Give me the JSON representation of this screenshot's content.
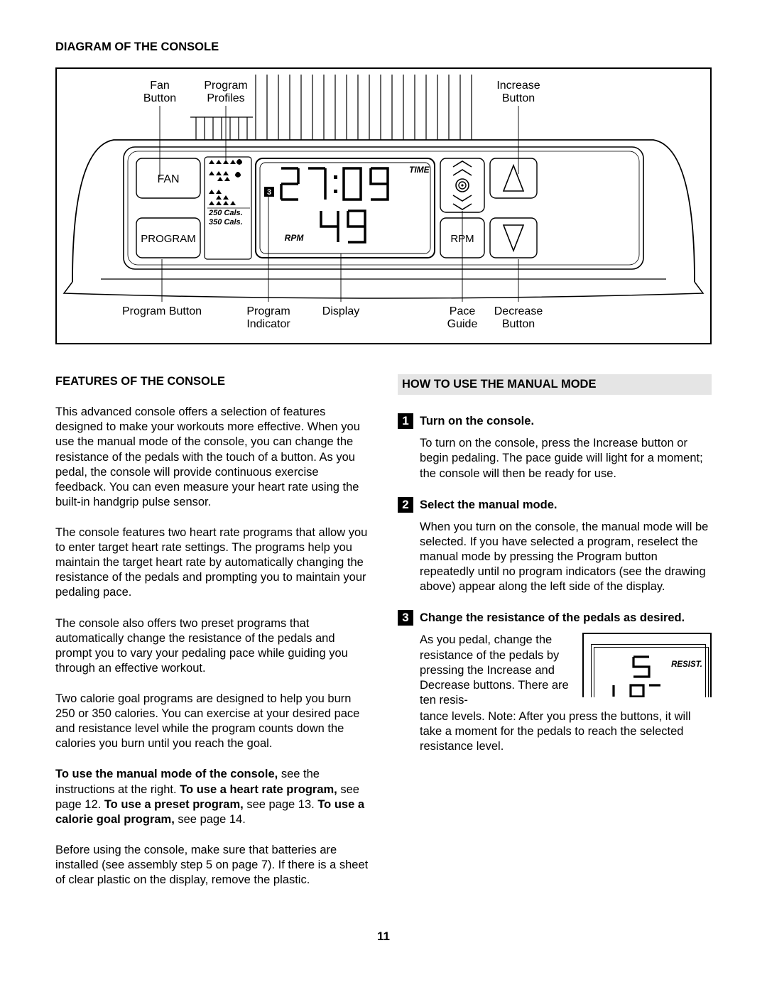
{
  "page_number": "11",
  "diagram": {
    "title": "DIAGRAM OF THE CONSOLE",
    "labels_top": {
      "fan_button": "Fan\nButton",
      "program_profiles": "Program\nProfiles",
      "increase_button": "Increase\nButton"
    },
    "labels_bottom": {
      "program_button": "Program Button",
      "program_indicator": "Program\nIndicator",
      "display": "Display",
      "pace_guide": "Pace\nGuide",
      "decrease_button": "Decrease\nButton"
    },
    "panel": {
      "fan": "FAN",
      "program": "PROGRAM",
      "cals_250": "250 Cals.",
      "cals_350": "350 Cals.",
      "indicator_num": "3",
      "time_label": "TIME",
      "rpm_small": "RPM",
      "big_time": "27:09",
      "big_rpm": "49",
      "rpm_btn": "RPM"
    }
  },
  "features": {
    "heading": "FEATURES OF THE CONSOLE",
    "p1": "This advanced console offers a selection of features designed to make your workouts more effective. When you use the manual mode of the console, you can change the resistance of the pedals with the touch of a button. As you pedal, the console will provide continuous exercise feedback. You can even measure your heart rate using the built-in handgrip pulse sensor.",
    "p2": "The console features two heart rate programs that allow you to enter target heart rate settings. The programs help you maintain the target heart rate by automatically changing the resistance of the pedals and prompting you to maintain your pedaling pace.",
    "p3": "The console also offers two preset programs that automatically change the resistance of the pedals and prompt you to vary your pedaling pace while guiding you through an effective workout.",
    "p4": "Two calorie goal programs are designed to help you burn 250 or 350 calories. You can exercise at your desired pace and resistance level while the program counts down the calories you burn until you reach the goal.",
    "p5_a": "To use the manual mode of the console,",
    "p5_b": " see the instructions at the right. ",
    "p5_c": "To use a heart rate program,",
    "p5_d": " see page 12. ",
    "p5_e": "To use a preset program,",
    "p5_f": " see page 13. ",
    "p5_g": "To use a calorie goal program,",
    "p5_h": " see page 14.",
    "p6": "Before using the console, make sure that batteries are installed (see assembly step 5 on page 7). If there is a sheet of clear plastic on the display, remove the plastic."
  },
  "manual": {
    "heading": "HOW TO USE THE MANUAL MODE",
    "step1": {
      "num": "1",
      "title": "Turn on the console.",
      "body": "To turn on the console, press the Increase button or begin pedaling. The pace guide will light for a moment; the console will then be ready for use."
    },
    "step2": {
      "num": "2",
      "title": "Select the manual mode.",
      "body": "When you turn on the console, the manual mode will be selected. If you have selected a program, reselect the manual mode by pressing the Program button repeatedly until no program indicators (see the drawing above) appear along the left side of the display."
    },
    "step3": {
      "num": "3",
      "title": "Change the resistance of the pedals as desired.",
      "body_a": "As you pedal, change the resistance of the pedals by pressing the Increase and Decrease buttons. There are ten resis-",
      "body_b": "tance levels. Note: After you press the buttons, it will take a moment for the pedals to reach the selected resistance level.",
      "resist_label": "RESIST."
    }
  }
}
